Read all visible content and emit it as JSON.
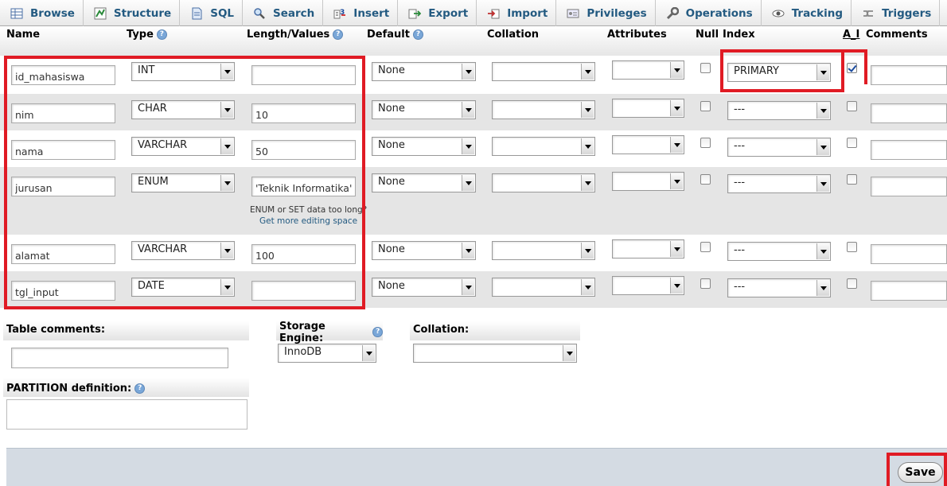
{
  "tabs": [
    {
      "label": "Browse",
      "icon": "browse-icon"
    },
    {
      "label": "Structure",
      "icon": "structure-icon"
    },
    {
      "label": "SQL",
      "icon": "sql-icon"
    },
    {
      "label": "Search",
      "icon": "search-icon"
    },
    {
      "label": "Insert",
      "icon": "insert-icon"
    },
    {
      "label": "Export",
      "icon": "export-icon"
    },
    {
      "label": "Import",
      "icon": "import-icon"
    },
    {
      "label": "Privileges",
      "icon": "privileges-icon"
    },
    {
      "label": "Operations",
      "icon": "operations-icon"
    },
    {
      "label": "Tracking",
      "icon": "tracking-icon"
    },
    {
      "label": "Triggers",
      "icon": "triggers-icon"
    }
  ],
  "columns": {
    "name": "Name",
    "type": "Type",
    "length": "Length/Values",
    "default": "Default",
    "collation": "Collation",
    "attributes": "Attributes",
    "null": "Null",
    "index": "Index",
    "ai": "A_I",
    "comments": "Comments"
  },
  "rows": [
    {
      "name": "id_mahasiswa",
      "type": "INT",
      "length": "",
      "default": "None",
      "collation": "",
      "attributes": "",
      "null": false,
      "index": "PRIMARY",
      "ai": true
    },
    {
      "name": "nim",
      "type": "CHAR",
      "length": "10",
      "default": "None",
      "collation": "",
      "attributes": "",
      "null": false,
      "index": "---",
      "ai": false
    },
    {
      "name": "nama",
      "type": "VARCHAR",
      "length": "50",
      "default": "None",
      "collation": "",
      "attributes": "",
      "null": false,
      "index": "---",
      "ai": false
    },
    {
      "name": "jurusan",
      "type": "ENUM",
      "length": "'Teknik Informatika','",
      "default": "None",
      "collation": "",
      "attributes": "",
      "null": false,
      "index": "---",
      "ai": false
    },
    {
      "name": "alamat",
      "type": "VARCHAR",
      "length": "100",
      "default": "None",
      "collation": "",
      "attributes": "",
      "null": false,
      "index": "---",
      "ai": false
    },
    {
      "name": "tgl_input",
      "type": "DATE",
      "length": "",
      "default": "None",
      "collation": "",
      "attributes": "",
      "null": false,
      "index": "---",
      "ai": false
    }
  ],
  "enum_hint": "ENUM or SET data too long?",
  "enum_link": "Get more editing space",
  "table_comments_label": "Table comments:",
  "storage_engine_label": "Storage Engine:",
  "storage_engine_value": "InnoDB",
  "collation_label": "Collation:",
  "partition_label": "PARTITION definition:",
  "save_label": "Save",
  "colors": {
    "tab_text": "#235a81",
    "highlight": "#e01b24",
    "row_alt": "#e5e5e5"
  }
}
